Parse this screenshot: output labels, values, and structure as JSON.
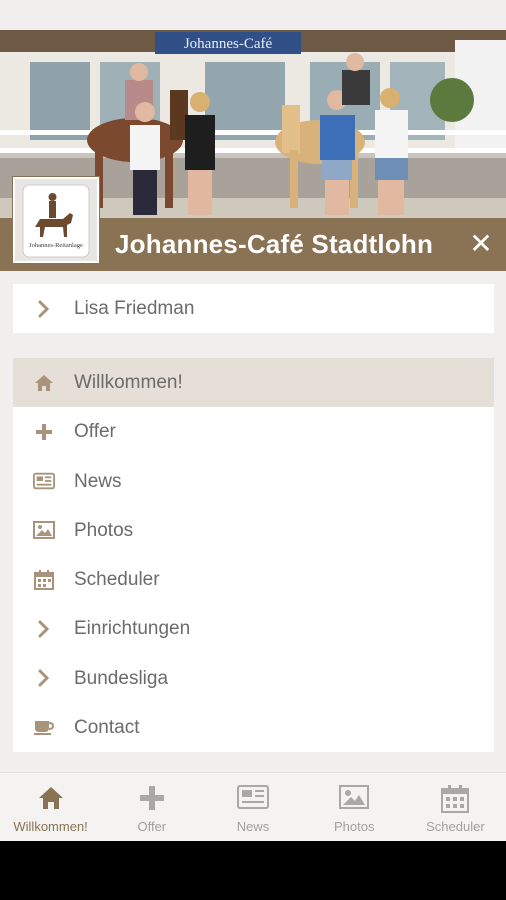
{
  "header": {
    "title": "Johannes-Café Stadtlohn",
    "close_icon": "close-icon",
    "sign_text": "Johannes-Café",
    "logo_text": "Johannes-Reitanlage"
  },
  "user": {
    "name": "Lisa Friedman",
    "icon": "chevron-right-icon"
  },
  "menu": {
    "items": [
      {
        "label": "Willkommen!",
        "icon": "home-icon",
        "active": true
      },
      {
        "label": "Offer",
        "icon": "plus-icon",
        "active": false
      },
      {
        "label": "News",
        "icon": "newspaper-icon",
        "active": false
      },
      {
        "label": "Photos",
        "icon": "image-icon",
        "active": false
      },
      {
        "label": "Scheduler",
        "icon": "calendar-icon",
        "active": false
      },
      {
        "label": "Einrichtungen",
        "icon": "chevron-right-icon",
        "active": false
      },
      {
        "label": "Bundesliga",
        "icon": "chevron-right-icon",
        "active": false
      },
      {
        "label": "Contact",
        "icon": "coffee-cup-icon",
        "active": false
      }
    ]
  },
  "tabs": [
    {
      "label": "Willkommen!",
      "icon": "home-icon",
      "active": true
    },
    {
      "label": "Offer",
      "icon": "plus-icon",
      "active": false
    },
    {
      "label": "News",
      "icon": "newspaper-icon",
      "active": false
    },
    {
      "label": "Photos",
      "icon": "image-icon",
      "active": false
    },
    {
      "label": "Scheduler",
      "icon": "calendar-icon",
      "active": false
    }
  ],
  "colors": {
    "accent": "#8a7354",
    "icon": "#a8947a",
    "active_bg": "#e5dfd7",
    "tab_inactive": "#a0a0a0"
  }
}
